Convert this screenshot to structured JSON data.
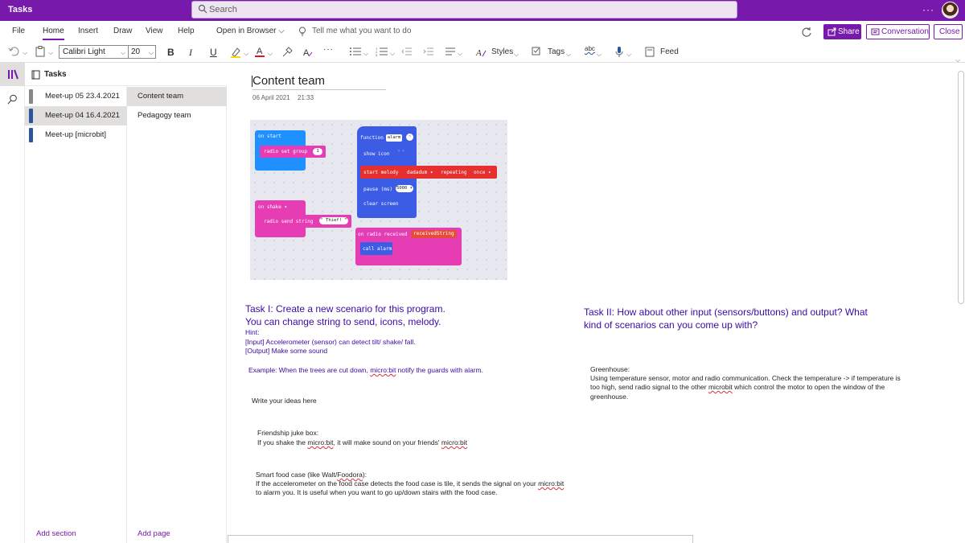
{
  "titlebar": {
    "app_title": "Tasks",
    "search_placeholder": "Search",
    "more": "···"
  },
  "ribbon": {
    "tabs": [
      "File",
      "Home",
      "Insert",
      "Draw",
      "View",
      "Help",
      "Open in Browser ⌵"
    ],
    "active_tab": "Home",
    "tell_me": "Tell me what you want to do",
    "share": "Share",
    "conversation": "Conversation",
    "close": "Close"
  },
  "toolbar": {
    "font_name": "Calibri Light",
    "font_size": "20",
    "bold": "B",
    "italic": "I",
    "underline": "U",
    "more": "···",
    "styles": "Styles",
    "tags": "Tags",
    "spelling": "abc",
    "feed": "Feed"
  },
  "notebook": {
    "name": "Tasks",
    "sections": [
      {
        "label": "Meet-up 05 23.4.2021",
        "color": "#8a8886"
      },
      {
        "label": "Meet-up 04 16.4.2021",
        "color": "#2b579a"
      },
      {
        "label": "Meet-up [microbit]",
        "color": "#2b579a"
      }
    ],
    "pages": [
      {
        "label": "Content team"
      },
      {
        "label": "Pedagogy team"
      }
    ],
    "add_section": "Add section",
    "add_page": "Add page"
  },
  "page": {
    "title": "Content team",
    "date": "06 April 2021",
    "time": "21:33"
  },
  "blocks": {
    "on_start": "on start",
    "radio_set_group": "radio set group",
    "group_value": "1",
    "function_alarm": "function",
    "alarm_name": "alarm",
    "show_icon": "show icon",
    "start_melody": "start melody",
    "melody_name": "dadadum ▾",
    "repeating": "repeating",
    "repeat_mode": "once ▾",
    "pause": "pause (ms)",
    "pause_value": "5000 ▾",
    "clear_screen": "clear screen",
    "on_shake": "on  shake ▾",
    "radio_send_string": "radio send string",
    "send_value": "\" Thief! \"",
    "on_radio_received": "on radio received",
    "received_var": "receivedString",
    "call_alarm": "call alarm",
    "colors": {
      "blue": "#1e90ff",
      "pink": "#e63cb4",
      "red": "#e63030",
      "purple_fn": "#3c5ce6",
      "orange_var": "#e64c3c"
    }
  },
  "task1": {
    "heading_line1": "Task I: Create a new scenario for this program.",
    "heading_line2": "You can change string to send, icons, melody.",
    "hint": "Hint:",
    "input_hint": "[Input] Accelerometer (sensor) can detect tilt/ shake/ fall.",
    "output_hint": "[Output] Make some sound",
    "example_prefix": "Example: When the trees are cut down, ",
    "example_word": "micro:bit",
    "example_suffix": " notify the guards with alarm.",
    "write_ideas": "Write your ideas here",
    "idea1_title": "Friendship juke box:",
    "idea1_prefix": "If you shake the ",
    "idea1_word1": "micro:bit",
    "idea1_mid": ", it will make sound on your friends' ",
    "idea1_word2": "micro:bit",
    "idea2_title_prefix": "Smart food case (like Walt/",
    "idea2_title_word": "Foodora",
    "idea2_title_suffix": "):",
    "idea2_line1_prefix": "If the accelerometer on the food case detects the food case is tile, it sends the signal on your ",
    "idea2_line1_word": "micro:bit",
    "idea2_line2": "to alarm you. It is useful when you want to go up/down stairs with the food case."
  },
  "task2": {
    "heading_line1": "Task II: How about other input (sensors/buttons) and output? What",
    "heading_line2": "kind of scenarios can you come up with?",
    "greenhouse_title": "Greenhouse:",
    "line1": "Using temperature sensor, motor and radio communication. Check the temperature -> if temperature is",
    "line2_prefix": "too high, send radio signal to the other ",
    "line2_word": "microbit",
    "line2_suffix": " which control the motor to open the window of the",
    "line3": "greenhouse."
  },
  "colors": {
    "brand": "#7719aa",
    "note_text": "#3b0aa5"
  }
}
